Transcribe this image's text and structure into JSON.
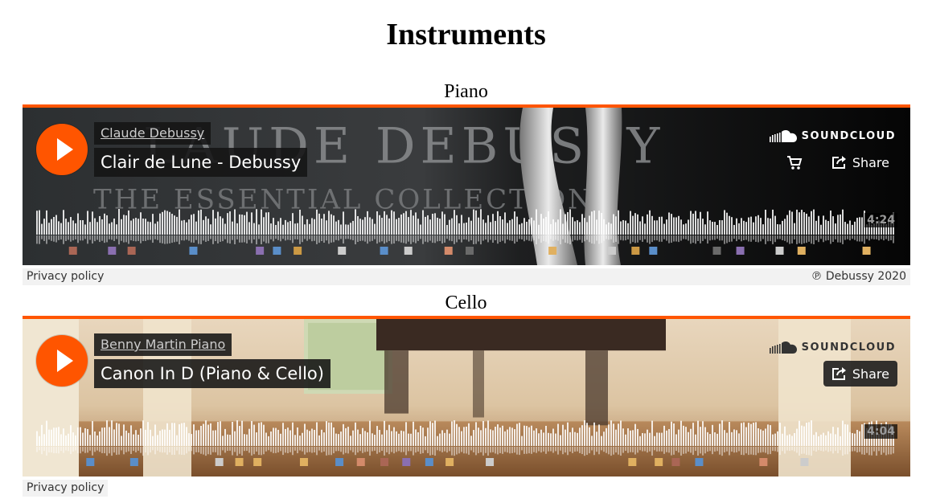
{
  "page": {
    "title": "Instruments"
  },
  "sections": [
    {
      "heading": "Piano",
      "player": {
        "artist": "Claude Debussy",
        "track": "Clair de Lune - Debussy",
        "brand": "SOUNDCLOUD",
        "share_label": "Share",
        "duration": "4:24",
        "privacy": "Privacy policy",
        "copyright": "℗ Debussy 2020",
        "icons": [
          "play-icon",
          "soundcloud-logo-icon",
          "cart-icon",
          "share-icon"
        ]
      }
    },
    {
      "heading": "Cello",
      "player": {
        "artist": "Benny Martin Piano",
        "track": "Canon In D (Piano & Cello)",
        "brand": "SOUNDCLOUD",
        "share_label": "Share",
        "duration": "4:04",
        "privacy": "Privacy policy",
        "icons": [
          "play-icon",
          "soundcloud-logo-icon",
          "share-icon"
        ]
      }
    }
  ],
  "colors": {
    "accent": "#ff5500",
    "footer_bg": "#f2f2f2"
  }
}
